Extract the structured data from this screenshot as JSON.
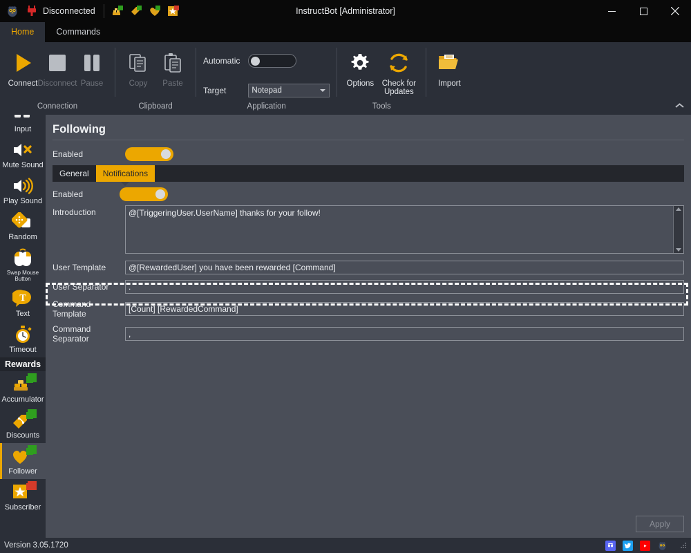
{
  "window": {
    "title": "InstructBot [Administrator]",
    "connection_status": "Disconnected",
    "minimize": "—",
    "maximize": "☐",
    "close": "✕"
  },
  "quick_access": {
    "logo_icon": "owl-logo-icon",
    "plug_icon": "disconnected-plug-icon",
    "items": [
      {
        "icon": "accumulator-icon",
        "badge_color": "#2f9e1f"
      },
      {
        "icon": "discounts-icon",
        "badge_color": "#2f9e1f"
      },
      {
        "icon": "follower-icon",
        "badge_color": "#2f9e1f"
      },
      {
        "icon": "subscriber-icon",
        "badge_color": "#d43b2a"
      }
    ]
  },
  "ribbon": {
    "tabs": [
      {
        "label": "Home",
        "active": true
      },
      {
        "label": "Commands",
        "active": false
      }
    ],
    "collapse_icon": "chevron-up-icon",
    "groups": [
      {
        "name": "Connection",
        "label": "Connection",
        "buttons": [
          {
            "label": "Connect",
            "icon": "play-icon",
            "enabled": true
          },
          {
            "label": "Disconnect",
            "icon": "stop-icon",
            "enabled": false
          },
          {
            "label": "Pause",
            "icon": "pause-icon",
            "enabled": false
          }
        ]
      },
      {
        "name": "Clipboard",
        "label": "Clipboard",
        "buttons": [
          {
            "label": "Copy",
            "icon": "copy-icon",
            "enabled": false
          },
          {
            "label": "Paste",
            "icon": "paste-icon",
            "enabled": false
          }
        ]
      },
      {
        "name": "Application",
        "label": "Application",
        "automatic_label": "Automatic",
        "automatic_on": false,
        "target_label": "Target",
        "target_value": "Notepad",
        "target_options": [
          "Notepad"
        ]
      },
      {
        "name": "Tools",
        "label": "Tools",
        "buttons": [
          {
            "label": "Options",
            "icon": "gear-icon",
            "enabled": true
          },
          {
            "label": "Check for Updates",
            "icon": "refresh-icon",
            "enabled": true
          }
        ],
        "import": {
          "label": "Import",
          "icon": "folder-open-icon",
          "enabled": true
        }
      }
    ]
  },
  "sidebar": {
    "items": [
      {
        "label": "Input",
        "icon": "input-icon",
        "selected": false,
        "clipped": true
      },
      {
        "label": "Mute Sound",
        "icon": "mute-sound-icon",
        "selected": false
      },
      {
        "label": "Play Sound",
        "icon": "play-sound-icon",
        "selected": false
      },
      {
        "label": "Random",
        "icon": "dice-icon",
        "selected": false
      },
      {
        "label": "Swap Mouse Button",
        "icon": "swap-mouse-icon",
        "selected": false,
        "small": true
      },
      {
        "label": "Text",
        "icon": "text-bubble-icon",
        "selected": false
      },
      {
        "label": "Timeout",
        "icon": "stopwatch-icon",
        "selected": false
      }
    ],
    "section_header": "Rewards",
    "reward_items": [
      {
        "label": "Accumulator",
        "icon": "accumulator-icon",
        "badge_color": "#2f9e1f",
        "selected": false
      },
      {
        "label": "Discounts",
        "icon": "discounts-icon",
        "badge_color": "#2f9e1f",
        "selected": false
      },
      {
        "label": "Follower",
        "icon": "follower-icon",
        "badge_color": "#2f9e1f",
        "selected": true
      },
      {
        "label": "Subscriber",
        "icon": "subscriber-icon",
        "badge_color": "#d43b2a",
        "selected": false
      }
    ]
  },
  "main": {
    "page_title": "Following",
    "enabled_label": "Enabled",
    "enabled_on": true,
    "tabs": [
      {
        "label": "General",
        "active": false
      },
      {
        "label": "Notifications",
        "active": true
      }
    ],
    "notifications": {
      "enabled_label": "Enabled",
      "enabled_on": true,
      "fields": [
        {
          "label": "Introduction",
          "value": "@[TriggeringUser.UserName] thanks for your follow!",
          "type": "textarea"
        },
        {
          "label": "User Template",
          "value": "@[RewardedUser] you have been rewarded [Command]",
          "type": "text"
        },
        {
          "label": "User Separator",
          "value": ".",
          "type": "text"
        },
        {
          "label": "Command Template",
          "value": "[Count] [RewardedCommand]",
          "type": "text",
          "highlighted": true
        },
        {
          "label": "Command Separator",
          "value": ",",
          "type": "text"
        }
      ]
    },
    "apply_label": "Apply",
    "apply_enabled": false
  },
  "statusbar": {
    "version": "Version 3.05.1720",
    "icons": [
      {
        "name": "discord-icon",
        "color": "#5865f2"
      },
      {
        "name": "twitter-icon",
        "color": "#1da1f2"
      },
      {
        "name": "youtube-icon",
        "color": "#ff0000"
      },
      {
        "name": "owl-logo-icon",
        "color": "#3a4a6b"
      }
    ]
  },
  "colors": {
    "accent": "#eca700",
    "window_bg": "#2b2f38",
    "content_bg": "#4a4e58",
    "titlebar_bg": "#090909"
  }
}
